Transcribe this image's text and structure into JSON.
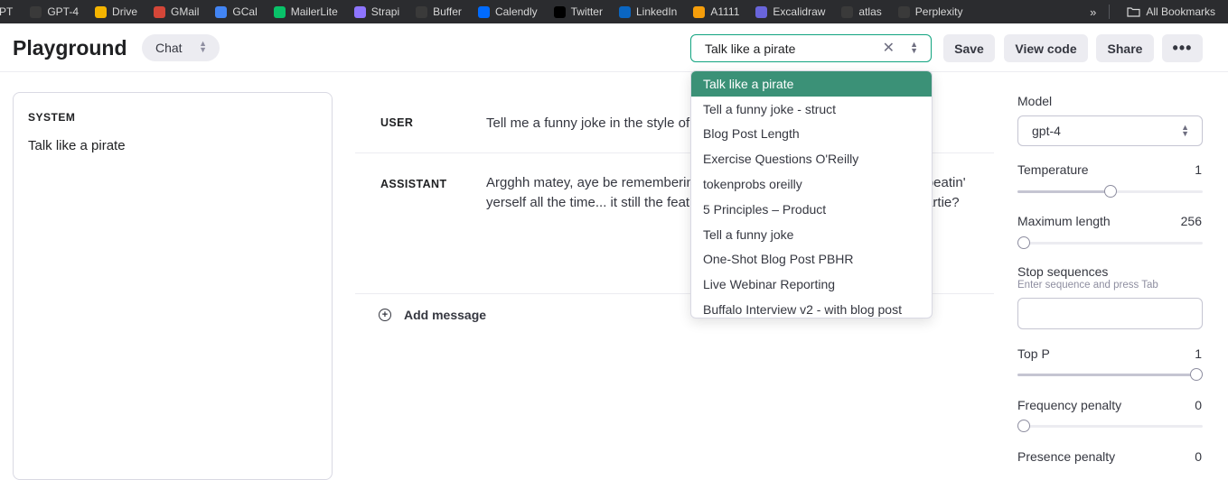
{
  "bookmarks": {
    "lead": "PT",
    "items": [
      {
        "label": "GPT-4",
        "icon": "openai-icon",
        "color": "#3a3a3a"
      },
      {
        "label": "Drive",
        "icon": "drive-icon",
        "color": "#f4b400"
      },
      {
        "label": "GMail",
        "icon": "gmail-icon",
        "color": "#d44638"
      },
      {
        "label": "GCal",
        "icon": "gcal-icon",
        "color": "#4285f4"
      },
      {
        "label": "MailerLite",
        "icon": "mailerlite-icon",
        "color": "#09c269"
      },
      {
        "label": "Strapi",
        "icon": "strapi-icon",
        "color": "#8e75ff"
      },
      {
        "label": "Buffer",
        "icon": "buffer-icon",
        "color": "#3a3a3a"
      },
      {
        "label": "Calendly",
        "icon": "calendly-icon",
        "color": "#006bff"
      },
      {
        "label": "Twitter",
        "icon": "x-icon",
        "color": "#000000"
      },
      {
        "label": "LinkedIn",
        "icon": "linkedin-icon",
        "color": "#0a66c2"
      },
      {
        "label": "A1111",
        "icon": "a1111-icon",
        "color": "#f59e0b"
      },
      {
        "label": "Excalidraw",
        "icon": "excalidraw-icon",
        "color": "#6965db"
      },
      {
        "label": "atlas",
        "icon": "atlas-icon",
        "color": "#3a3a3a"
      },
      {
        "label": "Perplexity",
        "icon": "perplexity-icon",
        "color": "#3a3a3a"
      }
    ],
    "overflow": "»",
    "all_bookmarks": "All Bookmarks"
  },
  "header": {
    "title": "Playground",
    "mode": "Chat",
    "preset_value": "Talk like a pirate",
    "save": "Save",
    "view_code": "View code",
    "share": "Share",
    "more": "•••"
  },
  "system": {
    "label": "SYSTEM",
    "text": "Talk like a pirate"
  },
  "messages": {
    "user_role": "USER",
    "user_text": "Tell me a funny joke in the style of a pirate",
    "assistant_role": "ASSISTANT",
    "assistant_text": "Argghh matey, aye be rememberin' this: \"Why'd me parrot stop tal... be repeatin' yerself all the time... it still the feathery beast, nobo... knee-slapper me heartie?",
    "add_message": "Add message"
  },
  "dropdown": {
    "items": [
      "Talk like a pirate",
      "Tell a funny joke - struct",
      "Blog Post Length",
      "Exercise Questions O'Reilly",
      "tokenprobs oreilly",
      "5 Principles – Product",
      "Tell a funny joke",
      "One-Shot Blog Post PBHR",
      "Live Webinar Reporting",
      "Buffalo Interview v2 - with blog post"
    ],
    "selected_index": 0
  },
  "settings": {
    "model_label": "Model",
    "model_value": "gpt-4",
    "temperature_label": "Temperature",
    "temperature_value": "1",
    "temperature_fraction": 0.5,
    "max_length_label": "Maximum length",
    "max_length_value": "256",
    "max_length_fraction": 0.03,
    "stop_label": "Stop sequences",
    "stop_hint": "Enter sequence and press Tab",
    "top_p_label": "Top P",
    "top_p_value": "1",
    "top_p_fraction": 1.0,
    "freq_label": "Frequency penalty",
    "freq_value": "0",
    "freq_fraction": 0.0,
    "presence_label": "Presence penalty",
    "presence_value": "0"
  },
  "colors": {
    "accent": "#10a37f",
    "dropdown_highlight": "#3b9177",
    "bookmarks_bg": "#2b2c2f"
  }
}
